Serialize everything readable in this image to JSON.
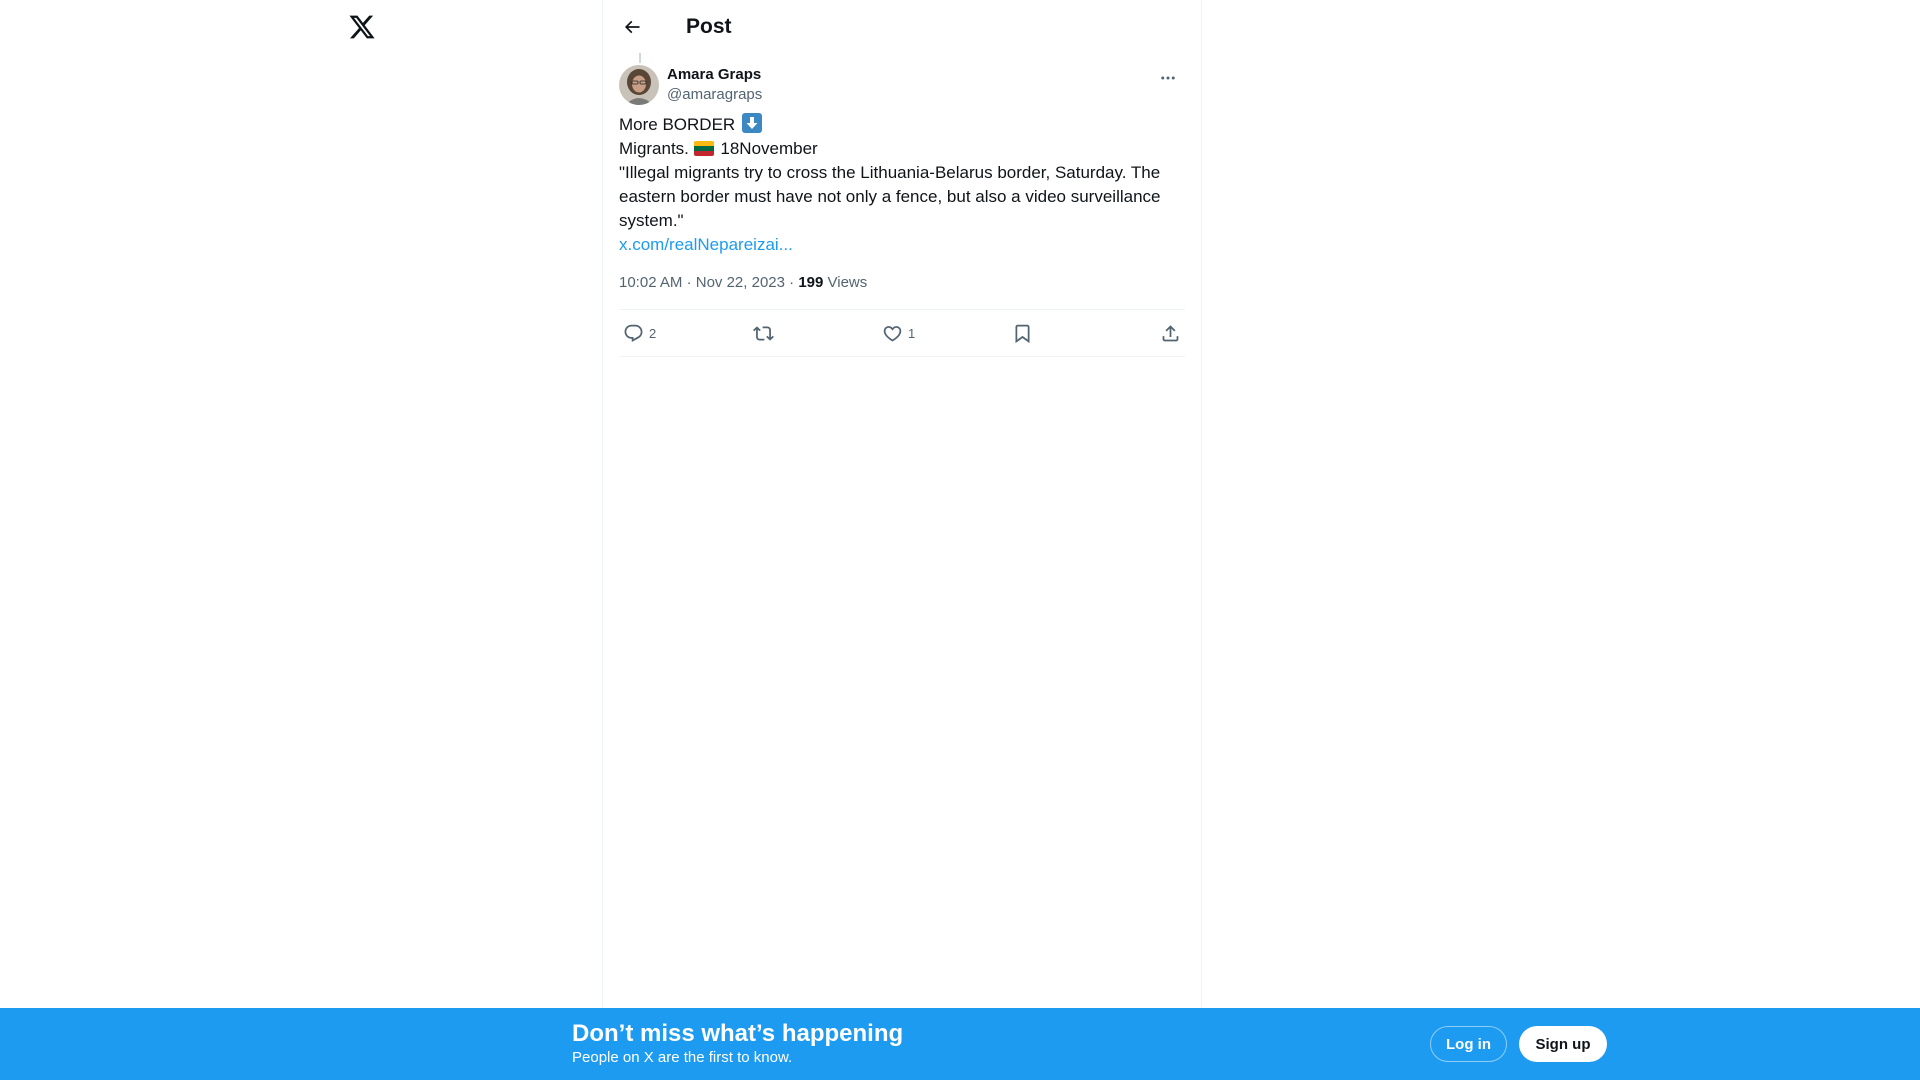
{
  "header": {
    "title": "Post"
  },
  "post": {
    "author": {
      "name": "Amara Graps",
      "handle": "@amaragraps"
    },
    "text_lines": [
      "More BORDER",
      "Migrants.",
      "18November",
      "\"Illegal migrants try to cross the Lithuania-Belarus border, Saturday. The eastern border must have not only a fence, but also a video surveillance system.\""
    ],
    "emoji": {
      "down_arrow": "down-arrow-emoji",
      "flag": "lithuania-flag-emoji",
      "flag_colors": [
        "#fdb913",
        "#006a44",
        "#c1272d"
      ]
    },
    "link": "x.com/realNepareizai...",
    "meta": {
      "time": "10:02 AM",
      "separator": "·",
      "date": "Nov 22, 2023",
      "views_count": "199",
      "views_label": "Views"
    },
    "actions": {
      "reply_count": "2",
      "retweet_count": "",
      "like_count": "1"
    }
  },
  "banner": {
    "title": "Don’t miss what’s happening",
    "subtitle": "People on X are the first to know.",
    "login_label": "Log in",
    "signup_label": "Sign up"
  },
  "colors": {
    "accent": "#1d9bf0",
    "text": "#0f1419",
    "muted": "#536471"
  }
}
